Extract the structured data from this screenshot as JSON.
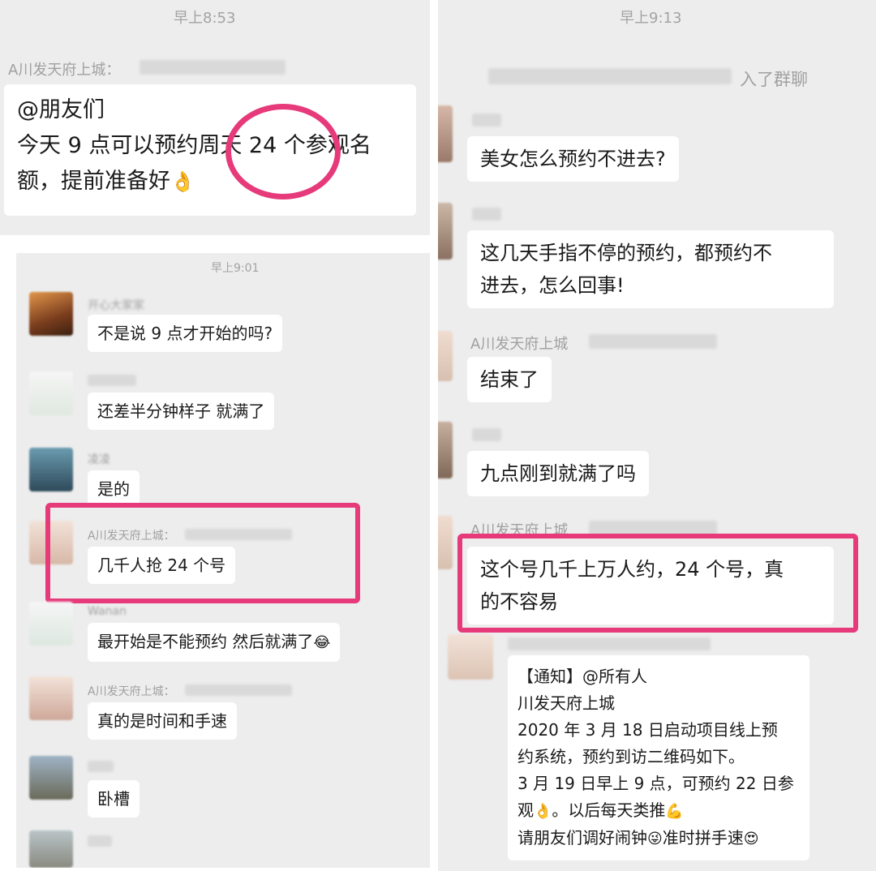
{
  "left_top": {
    "time": "早上8:53",
    "sender": "A川发天府上城：",
    "message": {
      "line1": "@朋友们",
      "line2": "今天 9 点可以预约周天 24 个参观名",
      "line3": "额，提前准备好"
    },
    "emoji": "👌"
  },
  "left_bottom": {
    "time": "早上9:01",
    "messages": [
      {
        "sender": "开心大家家",
        "text": "不是说 9 点才开始的吗?"
      },
      {
        "sender": "",
        "text": "还差半分钟样子 就满了"
      },
      {
        "sender": "凌凌",
        "text": "是的"
      },
      {
        "sender": "A川发天府上城：",
        "text": "几千人抢 24 个号"
      },
      {
        "sender": "Wanan",
        "text": "最开始是不能预约 然后就满了",
        "emoji": "😂"
      },
      {
        "sender": "A川发天府上城：",
        "text": "真的是时间和手速"
      },
      {
        "sender": "",
        "text": "卧槽"
      }
    ]
  },
  "right": {
    "time": "早上9:13",
    "system": "入了群聊",
    "messages": [
      {
        "sender": "",
        "text": "美女怎么预约不进去?"
      },
      {
        "sender": "",
        "line1": "这几天手指不停的预约，都预约不",
        "line2": "进去，怎么回事!"
      },
      {
        "sender": "A川发天府上城",
        "text": "结束了"
      },
      {
        "sender": "",
        "text": "九点刚到就满了吗"
      },
      {
        "sender": "A川发天府上城",
        "line1": "这个号几千上万人约，24 个号，真",
        "line2": "的不容易"
      }
    ],
    "notice": {
      "l1": "【通知】@所有人",
      "l2": "川发天府上城",
      "l3": "2020 年 3 月 18 日启动项目线上预",
      "l4": "约系统，预约到访二维码如下。",
      "l5": "3 月 19 日早上 9 点，可预约 22 日参",
      "l6a": "观",
      "l6e1": "👌",
      "l6b": "。以后每天类推",
      "l6e2": "💪",
      "l7a": "请朋友们调好闹钟",
      "l7e1": "😜",
      "l7b": "准时拼手速",
      "l7e2": "😍"
    }
  },
  "colors": {
    "highlight": "#e63a7a",
    "panel_bg": "#ededed",
    "bubble_bg": "#ffffff",
    "timestamp": "#a3a3a3"
  }
}
